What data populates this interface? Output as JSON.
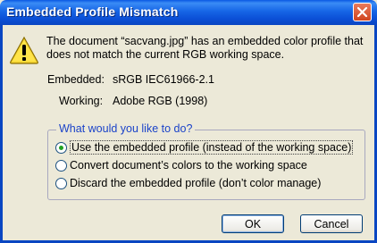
{
  "window": {
    "title": "Embedded Profile Mismatch"
  },
  "message": "The document “sacvang.jpg” has an embedded color profile that does not match the current RGB working space.",
  "embedded": {
    "label": "Embedded:",
    "value": "sRGB IEC61966-2.1"
  },
  "working": {
    "label": "Working:",
    "value": "Adobe RGB (1998)"
  },
  "group": {
    "legend": "What would you like to do?",
    "options": [
      {
        "label": "Use the embedded profile (instead of the working space)",
        "checked": true
      },
      {
        "label": "Convert document’s colors to the working space",
        "checked": false
      },
      {
        "label": "Discard the embedded profile (don’t color manage)",
        "checked": false
      }
    ]
  },
  "buttons": {
    "ok": "OK",
    "cancel": "Cancel"
  },
  "icons": {
    "warning": "warning-icon",
    "close": "close-icon"
  },
  "colors": {
    "title_bar": "#0a58e3",
    "dialog_bg": "#ece9d8",
    "legend": "#1b43c9"
  }
}
